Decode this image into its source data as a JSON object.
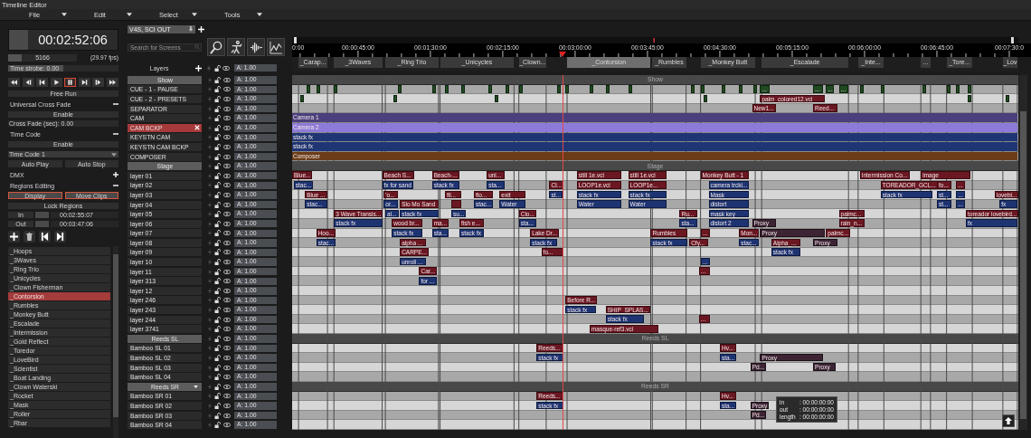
{
  "window": {
    "title": "Timeline Editor"
  },
  "menu": [
    {
      "label": "File"
    },
    {
      "label": "Edit"
    },
    {
      "label": "Select"
    },
    {
      "label": "Tools"
    }
  ],
  "time_display": {
    "value": "00:02:52:06"
  },
  "frame_counter": {
    "value": "5166",
    "level": 0.2
  },
  "fps": "(29.97 fps)",
  "strobe": {
    "label": "Time strobe: 0.00",
    "level": 0.5
  },
  "transport": [
    {
      "kind": "rewind",
      "selected": false
    },
    {
      "kind": "frame-back",
      "selected": false
    },
    {
      "kind": "prev",
      "selected": false
    },
    {
      "kind": "play",
      "selected": false
    },
    {
      "kind": "pause",
      "selected": true
    },
    {
      "kind": "next",
      "selected": false
    },
    {
      "kind": "frame-forward",
      "selected": false
    },
    {
      "kind": "fast-forward",
      "selected": false
    }
  ],
  "sections": [
    {
      "kind": "button",
      "label": "Free Run"
    },
    {
      "kind": "header",
      "label": "Universal Cross Fade",
      "expanded": true
    },
    {
      "kind": "button",
      "label": "Enable"
    },
    {
      "kind": "field",
      "label": "Cross Fade (sec): 0.00"
    },
    {
      "kind": "header",
      "label": "Time Code",
      "expanded": true
    },
    {
      "kind": "button",
      "label": "Enable"
    },
    {
      "kind": "dropdown",
      "label": "Time Code 1"
    },
    {
      "kind": "pair",
      "buttons": [
        {
          "label": "Auto Play",
          "selected": false
        },
        {
          "label": "Auto Stop",
          "selected": false
        }
      ]
    },
    {
      "kind": "header",
      "label": "DMX",
      "expanded": false
    },
    {
      "kind": "header",
      "label": "Regions Editing",
      "expanded": true
    },
    {
      "kind": "pair",
      "buttons": [
        {
          "label": "Display",
          "selected": true
        },
        {
          "label": "Move Clips",
          "selected": true
        }
      ]
    },
    {
      "kind": "button",
      "label": "Lock Regions"
    },
    {
      "kind": "range",
      "label": "In",
      "value": "00:02:55:07"
    },
    {
      "kind": "range",
      "label": "Out",
      "value": "00:03:47:06"
    }
  ],
  "region_list": [
    {
      "label": "_Hoops",
      "selected": false
    },
    {
      "label": "_3Waves",
      "selected": false
    },
    {
      "label": "_Ring Trio",
      "selected": false
    },
    {
      "label": "_Unicycles",
      "selected": false
    },
    {
      "label": "_Clown Fisherman",
      "selected": false
    },
    {
      "label": "_Contorsion",
      "selected": true
    },
    {
      "label": "_Rumbles",
      "selected": false
    },
    {
      "label": "_Monkey Butt",
      "selected": false
    },
    {
      "label": "_Escalade",
      "selected": false
    },
    {
      "label": "_Intermission",
      "selected": false
    },
    {
      "label": "_Gold Reflect",
      "selected": false
    },
    {
      "label": "_Toredor",
      "selected": false
    },
    {
      "label": "_LoveBird",
      "selected": false
    },
    {
      "label": "_Scientist",
      "selected": false
    },
    {
      "label": "_Boat Landing",
      "selected": false
    },
    {
      "label": "_Clown Waterski",
      "selected": false
    },
    {
      "label": "_Rocket",
      "selected": false
    },
    {
      "label": "_Mask",
      "selected": false
    },
    {
      "label": "_Roller",
      "selected": false
    },
    {
      "label": "_Rbar",
      "selected": false
    }
  ],
  "screen_tab": {
    "label": "V4S, SCI OUT"
  },
  "search": {
    "placeholder": "Search for Screens"
  },
  "layers_header": {
    "title": "Layers",
    "alpha": "A: 1.00"
  },
  "ruler": [
    "0:00",
    "00:00:45:00",
    "00:01:30:00",
    "00:02:15:00",
    "00:03:00:00",
    "00:03:45:00",
    "00:04:30:00",
    "00:05:15:00",
    "00:06:00:00",
    "00:06:45:00",
    "00:07:30:0"
  ],
  "regions": [
    {
      "label": "_Carap...",
      "selected": false
    },
    {
      "label": "_3Waves",
      "selected": false
    },
    {
      "label": "_Ring Trio",
      "selected": false
    },
    {
      "label": "_Unicycles",
      "selected": false
    },
    {
      "label": "_Clown...",
      "selected": false
    },
    {
      "label": "_Contorsion",
      "selected": true
    },
    {
      "label": "_Rumbles",
      "selected": false
    },
    {
      "label": "_Monkey Butt",
      "selected": false
    },
    {
      "label": "_Escalade",
      "selected": false
    },
    {
      "label": "_Inte...",
      "selected": false
    },
    {
      "label": "...",
      "selected": false
    },
    {
      "label": "_Tore...",
      "selected": false
    },
    {
      "label": "_Lov",
      "selected": false
    }
  ],
  "tracks": [
    {
      "name": "Show",
      "kind": "group",
      "band": "Show",
      "selected": false,
      "dropdown": false,
      "alpha": "A: 1.00"
    },
    {
      "name": "CUE - 1 - PAUSE",
      "kind": "layer",
      "selected": false,
      "alpha": "A: 1.00",
      "clips": [
        {
          "kind": "cue"
        },
        {
          "kind": "cue"
        },
        {
          "kind": "cue"
        },
        {
          "kind": "cue"
        },
        {
          "kind": "cue"
        },
        {
          "kind": "cue"
        },
        {
          "kind": "cue"
        },
        {
          "kind": "cue"
        },
        {
          "kind": "cue"
        },
        {
          "kind": "cue"
        },
        {
          "kind": "cue"
        },
        {
          "kind": "cue"
        },
        {
          "kind": "cue"
        },
        {
          "kind": "cue"
        },
        {
          "kind": "cue"
        },
        {
          "kind": "cue"
        },
        {
          "kind": "cue"
        },
        {
          "kind": "cue"
        },
        {
          "kind": "cue"
        },
        {
          "kind": "cue"
        },
        {
          "kind": "cue",
          "label": "..."
        },
        {
          "kind": "cue",
          "label": "..."
        },
        {
          "kind": "cue",
          "label": "..."
        },
        {
          "kind": "cue",
          "label": "..."
        },
        {
          "kind": "cue"
        },
        {
          "kind": "cue"
        },
        {
          "kind": "cue"
        },
        {
          "kind": "cue"
        },
        {
          "kind": "cue"
        },
        {
          "kind": "cue"
        }
      ]
    },
    {
      "name": "CUE - 2 - PRESETS",
      "kind": "layer",
      "selected": false,
      "alpha": "A: 1.00",
      "clips": [
        {
          "kind": "cue"
        },
        {
          "kind": "cue"
        },
        {
          "kind": "cue"
        },
        {
          "kind": "cue"
        },
        {
          "kind": "media",
          "label": "palm_colored12.vci"
        },
        {
          "kind": "cue"
        },
        {
          "kind": "cue"
        }
      ]
    },
    {
      "name": "SEPARATOR",
      "kind": "layer",
      "selected": false,
      "alpha": "A: 1.00",
      "clips": [
        {
          "kind": "media",
          "label": "New1..."
        },
        {
          "kind": "media",
          "label": "Reed..."
        }
      ]
    },
    {
      "name": "CAM",
      "kind": "layer",
      "selected": false,
      "alpha": "A: 1.00",
      "clips": [
        {
          "kind": "band",
          "label": "Camera 1",
          "color": "#4b3f7c"
        }
      ]
    },
    {
      "name": "CAM BCKP",
      "kind": "layer",
      "selected": true,
      "alpha": "A: 1.00",
      "clips": [
        {
          "kind": "band",
          "label": "Camera 2",
          "color": "#8e7ad8"
        }
      ]
    },
    {
      "name": "KEYSTN CAM",
      "kind": "layer",
      "selected": false,
      "alpha": "A: 1.00",
      "clips": [
        {
          "kind": "band",
          "label": "stack fx",
          "color": "#1f3574"
        }
      ]
    },
    {
      "name": "KEYSTN CAM BCKP",
      "kind": "layer",
      "selected": false,
      "alpha": "A: 1.00",
      "clips": [
        {
          "kind": "band",
          "label": "stack fx",
          "color": "#1f3574"
        }
      ]
    },
    {
      "name": "COMPOSER",
      "kind": "layer",
      "selected": false,
      "alpha": "A: 1.00",
      "clips": [
        {
          "kind": "band",
          "label": "Composer",
          "color": "#6b3c17"
        }
      ]
    },
    {
      "name": "Stage",
      "kind": "group",
      "band": "Stage",
      "selected": false,
      "dropdown": false,
      "alpha": "A: 1.00"
    },
    {
      "name": "layer 01",
      "kind": "layer",
      "selected": false,
      "alpha": "A: 1.00",
      "clips": [
        {
          "kind": "media",
          "label": "Blue..."
        },
        {
          "kind": "media",
          "label": "Beach S..."
        },
        {
          "kind": "media",
          "label": "Beach-..."
        },
        {
          "kind": "media",
          "label": "uni..."
        },
        {
          "kind": "media",
          "label": "still 1e.vci"
        },
        {
          "kind": "media",
          "label": "still 1e.vci"
        },
        {
          "kind": "media",
          "label": "Monkey Butt - 1"
        },
        {
          "kind": "media",
          "label": "Intermission Co..."
        },
        {
          "kind": "media",
          "label": "image"
        }
      ]
    },
    {
      "name": "layer 02",
      "kind": "layer",
      "selected": false,
      "alpha": "A: 1.00",
      "clips": [
        {
          "kind": "fx",
          "label": "stac..."
        },
        {
          "kind": "fx",
          "label": "fx for sand"
        },
        {
          "kind": "fx",
          "label": "stack fx"
        },
        {
          "kind": "fx",
          "label": "sta..."
        },
        {
          "kind": "media",
          "label": "Cl..."
        },
        {
          "kind": "media",
          "label": "LOOP1e.vci"
        },
        {
          "kind": "media",
          "label": "LOOP1e..."
        },
        {
          "kind": "fx",
          "label": "camera trcki..."
        },
        {
          "kind": "media",
          "label": "TOREADOR_GCL..."
        },
        {
          "kind": "media",
          "label": "fo..."
        },
        {
          "kind": "media",
          "label": "..."
        }
      ]
    },
    {
      "name": "layer 03",
      "kind": "layer",
      "selected": false,
      "alpha": "A: 1.00",
      "clips": [
        {
          "kind": "media",
          "label": "Blue ..."
        },
        {
          "kind": "media",
          "label": "'o..."
        },
        {
          "kind": "media",
          "label": "fil..."
        },
        {
          "kind": "media",
          "label": "flo..."
        },
        {
          "kind": "media",
          "label": "exit"
        },
        {
          "kind": "fx",
          "label": "st..."
        },
        {
          "kind": "fx",
          "label": "stack fx"
        },
        {
          "kind": "fx",
          "label": "stack fx"
        },
        {
          "kind": "fx",
          "label": "Mask"
        },
        {
          "kind": "fx",
          "label": "stack fx"
        },
        {
          "kind": "fx",
          "label": "st..."
        },
        {
          "kind": "fx",
          "label": "..."
        },
        {
          "kind": "media",
          "label": "lovebi..."
        }
      ]
    },
    {
      "name": "layer 04",
      "kind": "layer",
      "selected": false,
      "alpha": "A: 1.00",
      "clips": [
        {
          "kind": "fx",
          "label": "stac..."
        },
        {
          "kind": "fx",
          "label": "or..."
        },
        {
          "kind": "media",
          "label": "Slo Mo Sand"
        },
        {
          "kind": "media"
        },
        {
          "kind": "fx",
          "label": "stac..."
        },
        {
          "kind": "fx",
          "label": "Water"
        },
        {
          "kind": "fx",
          "label": "Water"
        },
        {
          "kind": "fx",
          "label": "Water"
        },
        {
          "kind": "fx",
          "label": "distort"
        },
        {
          "kind": "fx",
          "label": "st..."
        },
        {
          "kind": "fx",
          "label": "..."
        },
        {
          "kind": "fx",
          "label": "fx"
        }
      ]
    },
    {
      "name": "layer 05",
      "kind": "layer",
      "selected": false,
      "alpha": "A: 1.00",
      "clips": [
        {
          "kind": "media",
          "label": "3 Wave Transis..."
        },
        {
          "kind": "fx",
          "label": "al..."
        },
        {
          "kind": "fx",
          "label": "stack fx"
        },
        {
          "kind": "fx",
          "label": "su..."
        },
        {
          "kind": "media",
          "label": "Clo..."
        },
        {
          "kind": "media",
          "label": "Ru..."
        },
        {
          "kind": "fx",
          "label": "mask key"
        },
        {
          "kind": "media",
          "label": "palmc..."
        },
        {
          "kind": "media",
          "label": "toreador lovebird..."
        }
      ]
    },
    {
      "name": "layer 06",
      "kind": "layer",
      "selected": false,
      "alpha": "A: 1.00",
      "clips": [
        {
          "kind": "fx",
          "label": "stack fx"
        },
        {
          "kind": "media",
          "label": "wood br..."
        },
        {
          "kind": "media",
          "label": "ma..."
        },
        {
          "kind": "media",
          "label": "fish e..."
        },
        {
          "kind": "fx",
          "label": "sta..."
        },
        {
          "kind": "fx",
          "label": "sta..."
        },
        {
          "kind": "fx",
          "label": "distort 2"
        },
        {
          "kind": "proxy",
          "label": "Proxy"
        },
        {
          "kind": "media",
          "label": "rain_n..."
        },
        {
          "kind": "fx",
          "label": "fx"
        }
      ]
    },
    {
      "name": "layer 07",
      "kind": "layer",
      "selected": false,
      "alpha": "A: 1.00",
      "clips": [
        {
          "kind": "media",
          "label": "Hoo..."
        },
        {
          "kind": "fx",
          "label": "stack fx"
        },
        {
          "kind": "fx",
          "label": "sta..."
        },
        {
          "kind": "fx",
          "label": "stack fx"
        },
        {
          "kind": "media",
          "label": "Lake Dr..."
        },
        {
          "kind": "media",
          "label": "Rumbles"
        },
        {
          "kind": "media",
          "label": "..."
        },
        {
          "kind": "media",
          "label": "Mon..."
        },
        {
          "kind": "proxy",
          "label": "Proxy"
        },
        {
          "kind": "media",
          "label": "palmc..."
        }
      ]
    },
    {
      "name": "layer 08",
      "kind": "layer",
      "selected": false,
      "alpha": "A: 1.00",
      "clips": [
        {
          "kind": "fx",
          "label": "stac..."
        },
        {
          "kind": "media",
          "label": "alpha ..."
        },
        {
          "kind": "fx",
          "label": "stack fx"
        },
        {
          "kind": "fx",
          "label": "stack fx"
        },
        {
          "kind": "media",
          "label": "Cfy..."
        },
        {
          "kind": "fx",
          "label": "stac..."
        },
        {
          "kind": "media",
          "label": "Alpha_..."
        },
        {
          "kind": "proxy",
          "label": "Proxy"
        }
      ]
    },
    {
      "name": "layer 09",
      "kind": "layer",
      "selected": false,
      "alpha": "A: 1.00",
      "clips": [
        {
          "kind": "media",
          "label": "CARPE..."
        },
        {
          "kind": "media",
          "label": "fo..."
        },
        {
          "kind": "fx",
          "label": "stack fx"
        }
      ]
    },
    {
      "name": "layer 10",
      "kind": "layer",
      "selected": false,
      "alpha": "A: 1.00",
      "clips": [
        {
          "kind": "fx",
          "label": "unroll ..."
        },
        {
          "kind": "fx",
          "label": "..."
        }
      ]
    },
    {
      "name": "layer 11",
      "kind": "layer",
      "selected": false,
      "alpha": "A: 1.00",
      "clips": [
        {
          "kind": "media",
          "label": "Car..."
        },
        {
          "kind": "media",
          "label": "..."
        }
      ]
    },
    {
      "name": "layer 313",
      "kind": "layer",
      "selected": false,
      "alpha": "A: 1.00",
      "clips": [
        {
          "kind": "fx",
          "label": "for ..."
        }
      ]
    },
    {
      "name": "layer 12",
      "kind": "layer",
      "selected": false,
      "alpha": "A: 1.00"
    },
    {
      "name": "layer 246",
      "kind": "layer",
      "selected": false,
      "alpha": "A: 1.00",
      "clips": [
        {
          "kind": "media",
          "label": "Before R..."
        }
      ]
    },
    {
      "name": "layer 243",
      "kind": "layer",
      "selected": false,
      "alpha": "A: 1.00",
      "clips": [
        {
          "kind": "fx",
          "label": "stack fx"
        },
        {
          "kind": "media",
          "label": "SHIP_SPLAS..."
        }
      ]
    },
    {
      "name": "layer 244",
      "kind": "layer",
      "selected": false,
      "alpha": "A: 1.00",
      "clips": [
        {
          "kind": "fx",
          "label": "stack fx"
        },
        {
          "kind": "media",
          "label": "..."
        }
      ]
    },
    {
      "name": "layer 3741",
      "kind": "layer",
      "selected": false,
      "alpha": "A: 1.00",
      "clips": [
        {
          "kind": "media",
          "label": "masque-ref3.vci"
        }
      ]
    },
    {
      "name": "Reeds SL",
      "kind": "group",
      "band": "Reeds SL",
      "selected": false,
      "dropdown": false,
      "alpha": "A: 1.00"
    },
    {
      "name": "Bamboo SL 01",
      "kind": "layer",
      "selected": false,
      "alpha": "A: 1.00",
      "clips": [
        {
          "kind": "media",
          "label": "Reeds..."
        },
        {
          "kind": "media",
          "label": "Hv..."
        }
      ]
    },
    {
      "name": "Bamboo SL 02",
      "kind": "layer",
      "selected": false,
      "alpha": "A: 1.00",
      "clips": [
        {
          "kind": "fx",
          "label": "stack fx"
        },
        {
          "kind": "fx",
          "label": "sta..."
        },
        {
          "kind": "proxy",
          "label": "Proxy"
        }
      ]
    },
    {
      "name": "Bamboo SL 03",
      "kind": "layer",
      "selected": false,
      "alpha": "A: 1.00",
      "clips": [
        {
          "kind": "proxy",
          "label": "Pd..."
        },
        {
          "kind": "proxy",
          "label": "Proxy"
        }
      ]
    },
    {
      "name": "Bamboo SL 04",
      "kind": "layer",
      "selected": false,
      "alpha": "A: 1.00"
    },
    {
      "name": "Reeds SR",
      "kind": "group",
      "band": "Reeds SR",
      "selected": false,
      "dropdown": true,
      "alpha": "A: 1.00"
    },
    {
      "name": "Bamboo SR 01",
      "kind": "layer",
      "selected": false,
      "alpha": "A: 1.00",
      "clips": [
        {
          "kind": "media",
          "label": "Reeds..."
        },
        {
          "kind": "media",
          "label": "Hv..."
        }
      ]
    },
    {
      "name": "Bamboo SR 02",
      "kind": "layer",
      "selected": false,
      "alpha": "A: 1.00",
      "clips": [
        {
          "kind": "fx",
          "label": "stack fx"
        },
        {
          "kind": "fx",
          "label": "sta..."
        },
        {
          "kind": "proxy",
          "label": "Proxy"
        }
      ]
    },
    {
      "name": "Bamboo SR 03",
      "kind": "layer",
      "selected": false,
      "alpha": "A: 1.00",
      "clips": [
        {
          "kind": "proxy",
          "label": "Pd..."
        }
      ]
    },
    {
      "name": "Bamboo SR 04",
      "kind": "layer",
      "selected": false,
      "alpha": "A: 1.00"
    }
  ],
  "tooltip": [
    {
      "label": "in",
      "value": ": 00:00:00:00"
    },
    {
      "label": "out",
      "value": ": 00:00:00:00"
    },
    {
      "label": "length",
      "value": ": 00:00:00:00"
    }
  ]
}
